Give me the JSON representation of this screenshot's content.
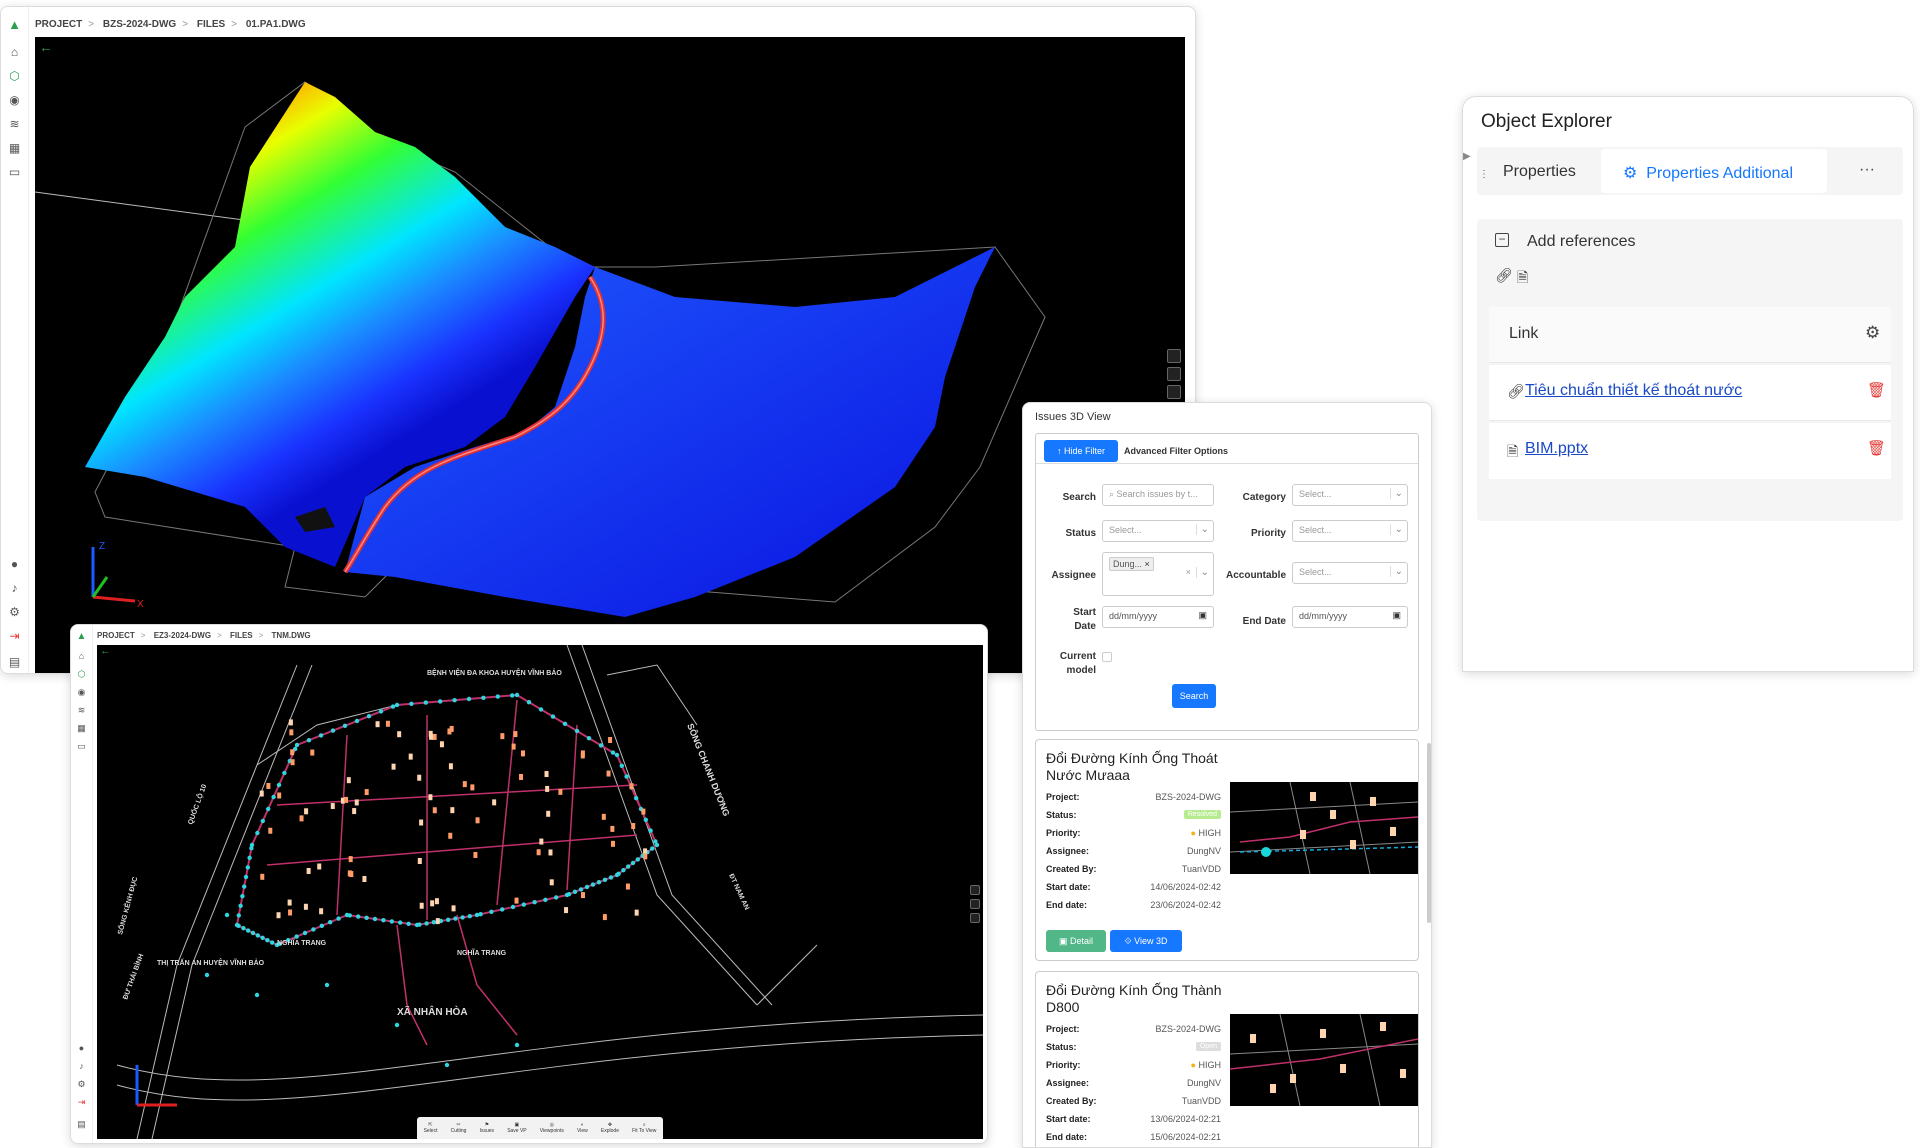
{
  "win1": {
    "breadcrumb": [
      "PROJECT",
      "BZS-2024-DWG",
      "FILES",
      "01.PA1.DWG"
    ],
    "back_icon": "arrow-left-icon"
  },
  "win2": {
    "breadcrumb": [
      "PROJECT",
      "EZ3-2024-DWG",
      "FILES",
      "TNM.DWG"
    ],
    "map_labels": {
      "hospital": "BỆNH VIỆN ĐA KHOA HUYỆN VĨNH BẢO",
      "river_right": "SÔNG CHANH DƯƠNG",
      "highway": "QUỐC LỘ 10",
      "river_left": "SÔNG KÊNH ĐỤC",
      "road_left": "ĐƯ THÁI BÌNH",
      "town": "THỊ TRẤN AN HUYỆN VĨNH BẢO",
      "cemetery1": "NGHĨA TRANG",
      "cemetery2": "NGHĨA TRANG",
      "commune": "XÃ NHÂN HÒA",
      "road_right": "ĐT NAM AN"
    },
    "toolbar": [
      "Select",
      "Cutting",
      "Issues",
      "Save VP",
      "Viewpoints",
      "View",
      "Explode",
      "Fit To View"
    ]
  },
  "issues": {
    "title": "Issues 3D View",
    "hide_filter": "Hide Filter",
    "advanced": "Advanced Filter Options",
    "filters": {
      "search_label": "Search",
      "search_placeholder": "Search issues by t...",
      "category_label": "Category",
      "status_label": "Status",
      "priority_label": "Priority",
      "assignee_label": "Assignee",
      "assignee_tag": "Dung...",
      "accountable_label": "Accountable",
      "start_label": "Start Date",
      "end_label": "End Date",
      "date_placeholder": "dd/mm/yyyy",
      "current_label": "Current model",
      "select_placeholder": "Select...",
      "search_button": "Search"
    },
    "field_labels": {
      "project": "Project:",
      "status": "Status:",
      "priority": "Priority:",
      "assignee": "Assignee:",
      "created": "Created By:",
      "start": "Start date:",
      "end": "End date:"
    },
    "cards": [
      {
        "title": "Đổi Đường Kính Ống Thoát Nước Mưaaa",
        "project": "BZS-2024-DWG",
        "status": "Resolved",
        "priority": "HIGH",
        "assignee": "DungNV",
        "created_by": "TuanVDD",
        "start": "14/06/2024-02:42",
        "end": "23/06/2024-02:42",
        "detail_btn": "Detail",
        "view_btn": "View 3D"
      },
      {
        "title": "Đổi Đường Kính Ống Thành D800",
        "project": "BZS-2024-DWG",
        "status": "Open",
        "priority": "HIGH",
        "assignee": "DungNV",
        "created_by": "TuanVDD",
        "start": "13/06/2024-02:21",
        "end": "15/06/2024-02:21"
      }
    ]
  },
  "explorer": {
    "title": "Object Explorer",
    "tab_properties": "Properties",
    "tab_additional": "Properties Additional",
    "more": "···",
    "add_references": "Add references",
    "link_header": "Link",
    "links": [
      {
        "text": "Tiêu chuẩn thiết kế thoát nước",
        "icon": "link-icon"
      },
      {
        "text": "BIM.pptx",
        "icon": "file-icon"
      }
    ]
  },
  "colors": {
    "accent": "#1677ff",
    "danger": "#e53935",
    "success": "#52c41a"
  }
}
